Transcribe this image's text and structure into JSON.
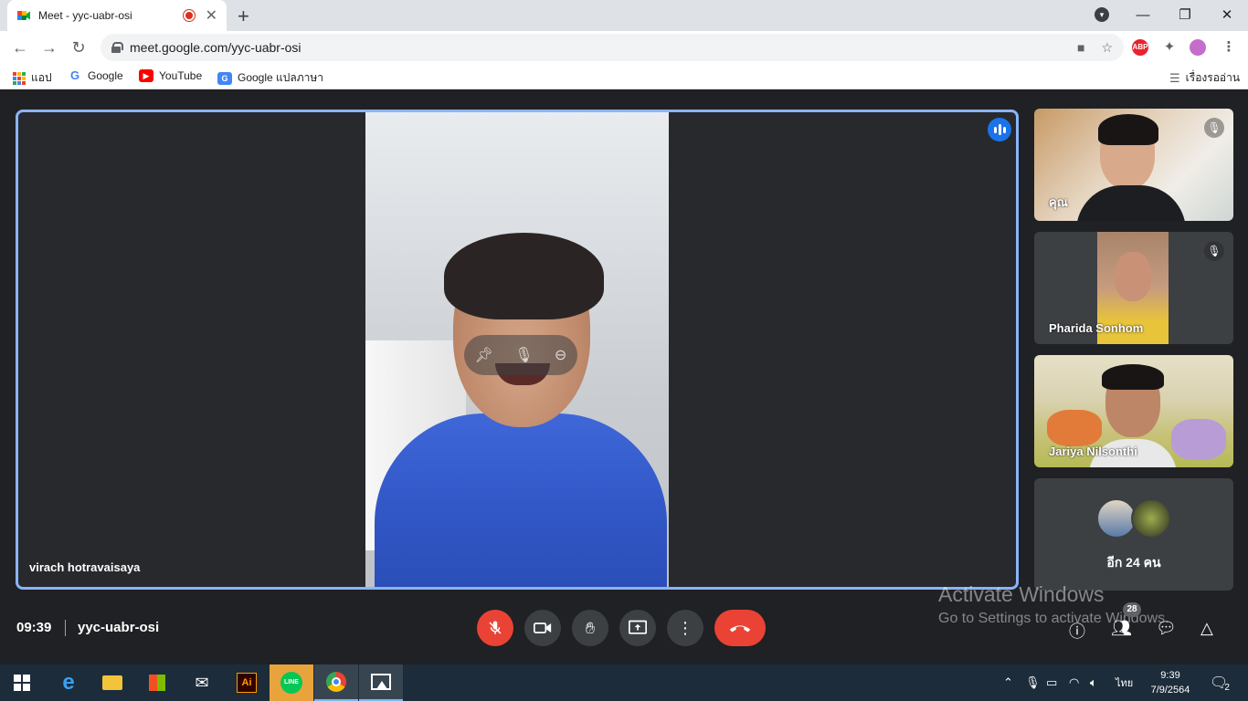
{
  "browser": {
    "tab_title": "Meet - yyc-uabr-osi",
    "new_tab": "+",
    "url": "meet.google.com/yyc-uabr-osi",
    "ext_abp": "ABP",
    "window_minimize": "—",
    "window_restore": "❐",
    "window_close": "✕"
  },
  "bookmarks": {
    "apps": "แอป",
    "google": "Google",
    "youtube": "YouTube",
    "translate": "Google แปลภาษา",
    "reading_list": "เรื่องรออ่าน"
  },
  "meet": {
    "main_speaker": "virach hotravaisaya",
    "participants": [
      {
        "name": "คุณ",
        "muted": true
      },
      {
        "name": "Pharida Sonhom",
        "muted": true
      },
      {
        "name": "Jariya Nilsonthi",
        "muted": false
      }
    ],
    "more_label": "อีก 24 คน",
    "time": "09:39",
    "meeting_code": "yyc-uabr-osi",
    "people_count": "28"
  },
  "watermark": {
    "line1": "Activate Windows",
    "line2": "Go to Settings to activate Windows."
  },
  "taskbar": {
    "time": "9:39",
    "date": "7/9/2564",
    "language": "ไทย",
    "notifications": "2"
  },
  "colors": {
    "accent": "#8ab4f8",
    "hangup": "#ea4335",
    "speaking": "#1a73e8"
  }
}
